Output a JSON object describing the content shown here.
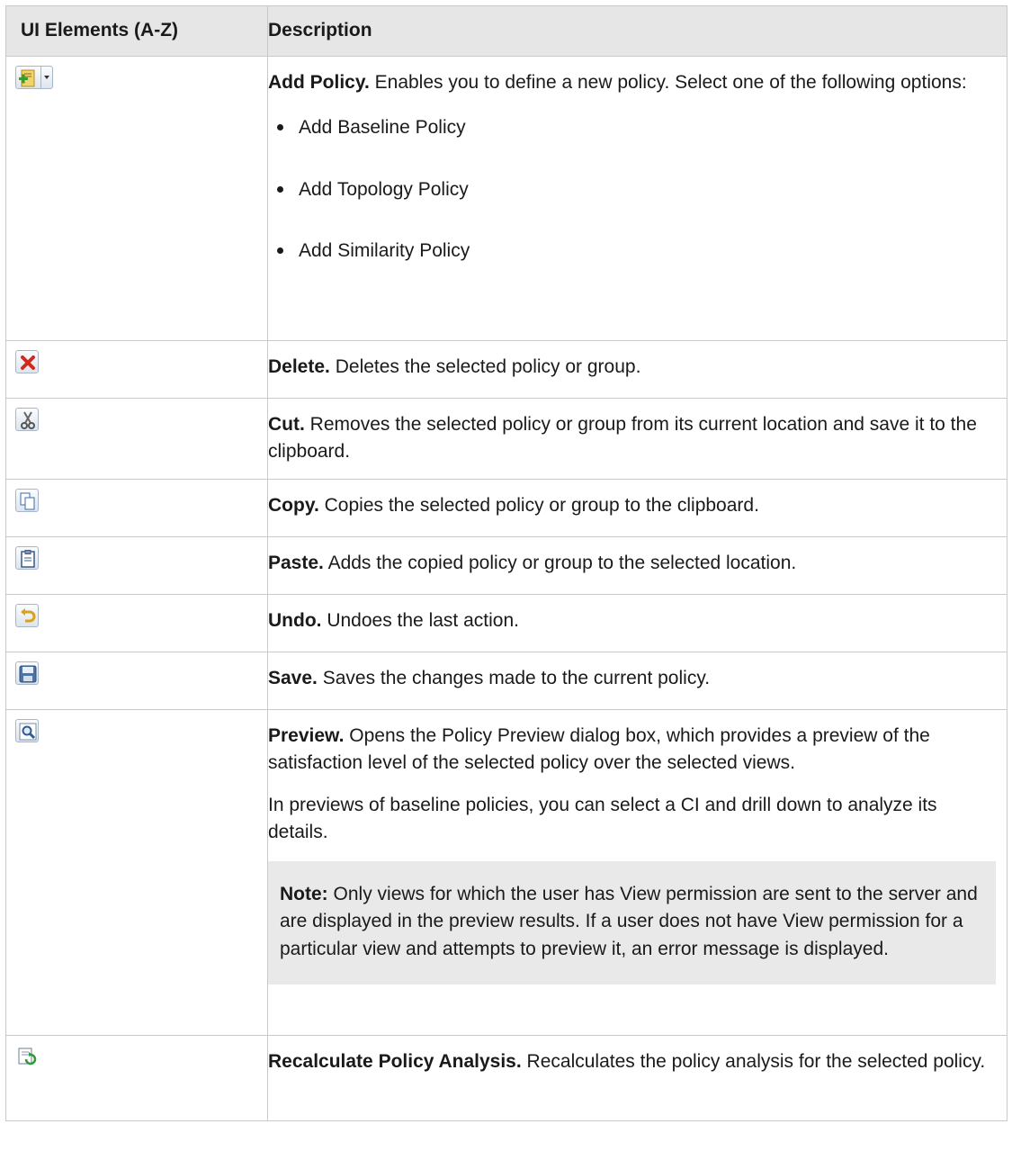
{
  "table": {
    "headers": {
      "col1": "UI Elements (A-Z)",
      "col2": "Description"
    },
    "rows": [
      {
        "icon": "add-policy-icon",
        "title": "Add Policy.",
        "text": "Enables you to define a new policy. Select one of the following options:",
        "options": [
          "Add Baseline Policy",
          "Add Topology Policy",
          "Add Similarity Policy"
        ]
      },
      {
        "icon": "delete-icon",
        "title": "Delete.",
        "text": "Deletes the selected policy or group."
      },
      {
        "icon": "cut-icon",
        "title": "Cut.",
        "text": "Removes the selected policy or group from its current location and save it to the clipboard."
      },
      {
        "icon": "copy-icon",
        "title": "Copy.",
        "text": "Copies the selected policy or group to the clipboard."
      },
      {
        "icon": "paste-icon",
        "title": "Paste.",
        "text": "Adds the copied policy or group to the selected location."
      },
      {
        "icon": "undo-icon",
        "title": "Undo.",
        "text": "Undoes the last action."
      },
      {
        "icon": "save-icon",
        "title": "Save.",
        "text": "Saves the changes made to the current policy."
      },
      {
        "icon": "preview-icon",
        "title": "Preview.",
        "text": "Opens the Policy Preview dialog box, which provides a preview of the satisfaction level of the selected policy over the selected views.",
        "text2": "In previews of baseline policies, you can select a CI and drill down to analyze its details.",
        "note_label": "Note:",
        "note_text": "Only views for which the user has View permission are sent to the server and are displayed in the preview results. If a user does not have View permission for a particular view and attempts to preview it, an error message is displayed."
      },
      {
        "icon": "recalculate-icon",
        "title": "Recalculate Policy Analysis.",
        "text": "Recalculates the policy analysis for the selected policy."
      }
    ]
  }
}
